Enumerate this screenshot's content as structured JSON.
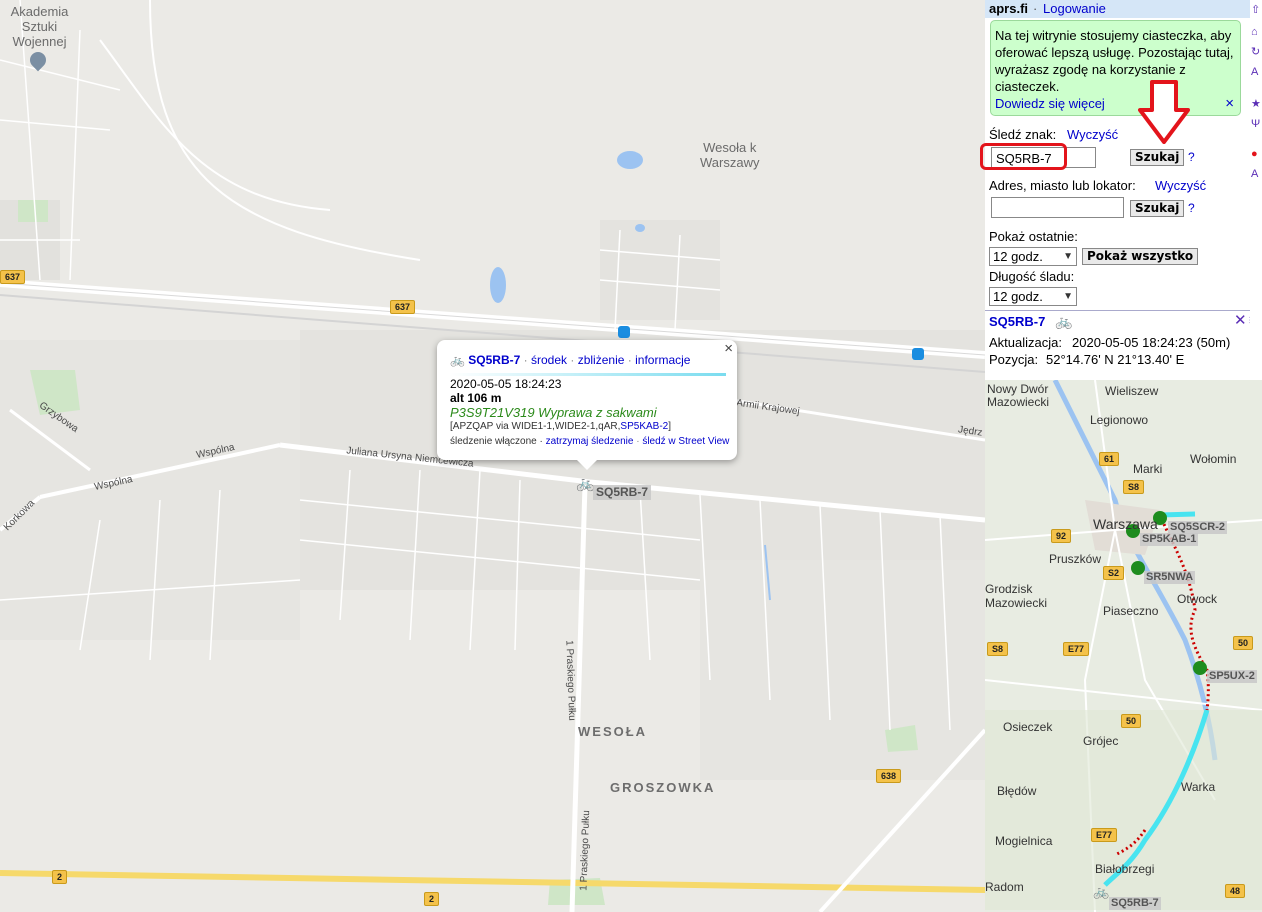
{
  "map": {
    "labels": {
      "akademia": "Akademia\nSztuki\nWojennej",
      "wesola_k": "Wesoła k\nWarszawy",
      "wesola": "WESOŁA",
      "groszowka": "GROSZOWKA"
    },
    "roads": {
      "grzybowa": "Grzybowa",
      "wspolna1": "Wspólna",
      "wspolna2": "Wspólna",
      "korkowa": "Korkowa",
      "ursyna": "Juliana Ursyna Niemcewicza",
      "armii": "Armii Krajowej",
      "jedrz": "Jędrz",
      "praskiego1": "1 Praskiego Pułku",
      "praskiego2": "1 Praskiego Pułku"
    },
    "shields": [
      "637",
      "637",
      "638",
      "2",
      "2"
    ],
    "station_tag": "SQ5RB-7",
    "popup": {
      "callsign": "SQ5RB-7",
      "links": [
        "środek",
        "zbliżenie",
        "informacje"
      ],
      "timestamp": "2020-05-05 18:24:23",
      "altitude": "alt 106 m",
      "comment": "P3S9T21V319 Wyprawa z sakwami",
      "path_prefix": "[APZQAP via WIDE1-1,WIDE2-1,qAR,",
      "path_link": "SP5KAB-2",
      "path_suffix": "]",
      "tracking_prefix": "śledzenie włączone · ",
      "tracking_links": [
        "zatrzymaj śledzenie",
        "śledź w Street View"
      ],
      "close": "×"
    }
  },
  "sidebar": {
    "site": "aprs.fi",
    "login": "Logowanie",
    "cookie_text": "Na tej witrynie stosujemy ciasteczka, aby oferować lepszą usługę. Pozostając tutaj, wyrażasz zgodę na korzystanie z ciasteczek.",
    "cookie_link": "Dowiedz się więcej",
    "cookie_close": "×",
    "track_label": "Śledź znak:",
    "clear": "Wyczyść",
    "callsign_value": "SQ5RB-7",
    "search_btn": "Szukaj",
    "help": "?",
    "address_label": "Adres, miasto lub lokator:",
    "address_clear": "Wyczyść",
    "address_value": "",
    "search_btn2": "Szukaj",
    "show_last_label": "Pokaż ostatnie:",
    "show_last_value": "12 godz.",
    "show_all_btn": "Pokaż wszystko",
    "track_len_label": "Długość śladu:",
    "track_len_value": "12 godz.",
    "station": {
      "callsign": "SQ5RB-7",
      "updated_label": "Aktualizacja:",
      "updated_value": "2020-05-05 18:24:23 (50m)",
      "position_label": "Pozycja:",
      "position_value": "52°14.76' N 21°13.40' E"
    }
  },
  "minimap": {
    "places": [
      "Nowy Dwór\nMazowiecki",
      "Wieliszew",
      "Legionowo",
      "Marki",
      "Wołomin",
      "Warszawa",
      "Pruszków",
      "Piaseczno",
      "Otwock",
      "Grodzisk\nMazowiecki",
      "Osieczek",
      "Grójec",
      "Warka",
      "Błędów",
      "Mogielnica",
      "Białobrzegi",
      "Radom"
    ],
    "tags": [
      "SQ5SCR-2",
      "SP5KAB-1",
      "SR5NWA",
      "SP5UX-2",
      "SQ5RB-7"
    ],
    "shields": [
      "61",
      "S8",
      "92",
      "S2",
      "S8",
      "E77",
      "50",
      "50",
      "E77",
      "48"
    ]
  },
  "colors": {
    "link": "#0000cc",
    "cookie_bg": "#ccffcc",
    "header_bg": "#d5e6f7",
    "annotation_red": "#e3141b",
    "track_red": "#cc0000",
    "track_cyan": "#48e4f0"
  }
}
